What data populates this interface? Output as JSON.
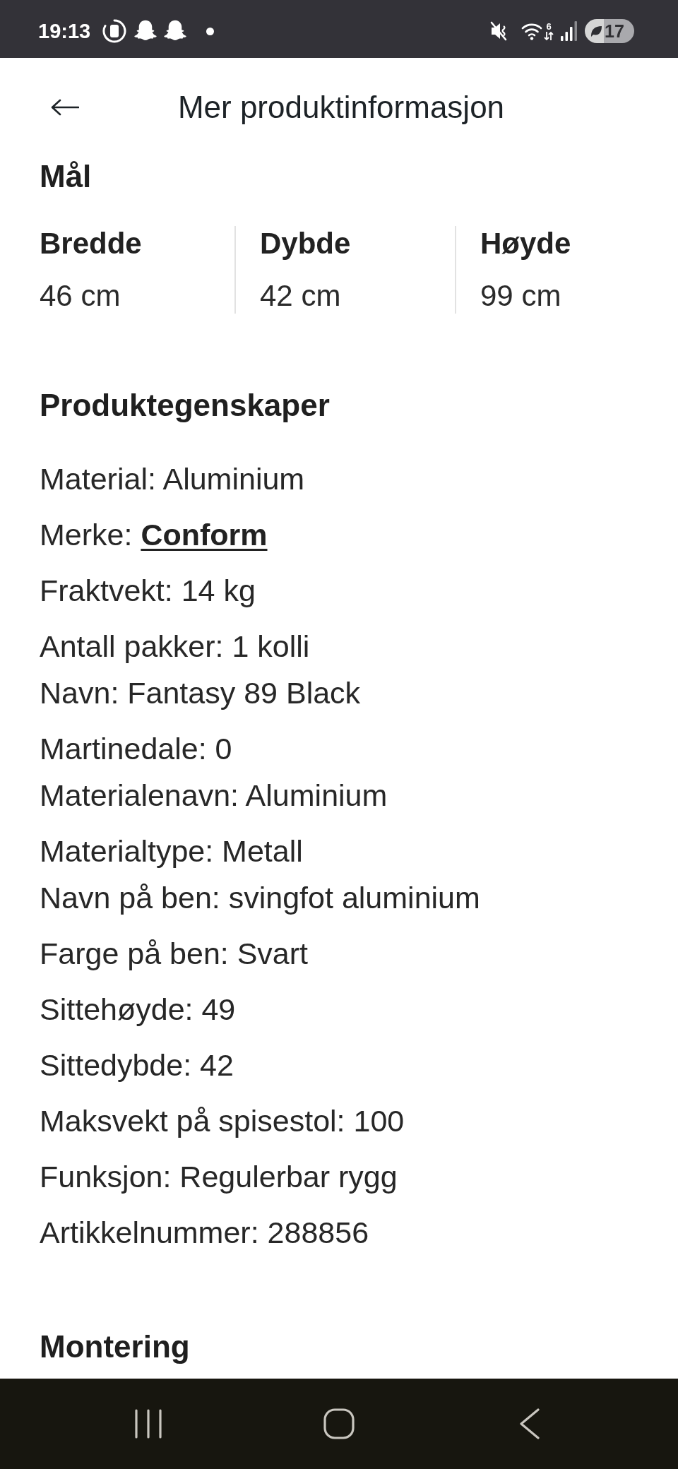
{
  "status_bar": {
    "time": "19:13",
    "wifi_badge": "6",
    "battery": "17"
  },
  "header": {
    "title": "Mer produktinformasjon"
  },
  "dimensions": {
    "heading": "Mål",
    "items": [
      {
        "label": "Bredde",
        "value": "46 cm"
      },
      {
        "label": "Dybde",
        "value": "42 cm"
      },
      {
        "label": "Høyde",
        "value": "99 cm"
      }
    ]
  },
  "properties": {
    "heading": "Produktegenskaper",
    "groups": [
      {
        "lines": [
          {
            "text": "Material: Aluminium"
          }
        ]
      },
      {
        "lines": [
          {
            "text": "Merke:",
            "link": "Conform"
          }
        ]
      },
      {
        "lines": [
          {
            "text": "Fraktvekt: 14 kg"
          }
        ]
      },
      {
        "lines": [
          {
            "text": "Antall pakker: 1 kolli"
          },
          {
            "text": "Navn: Fantasy 89 Black"
          }
        ]
      },
      {
        "lines": [
          {
            "text": "Martinedale: 0"
          },
          {
            "text": "Materialenavn: Aluminium"
          }
        ]
      },
      {
        "lines": [
          {
            "text": "Materialtype: Metall"
          },
          {
            "text": "Navn på ben: svingfot aluminium"
          }
        ]
      },
      {
        "lines": [
          {
            "text": "Farge på ben: Svart"
          }
        ]
      },
      {
        "lines": [
          {
            "text": "Sittehøyde: 49"
          }
        ]
      },
      {
        "lines": [
          {
            "text": "Sittedybde: 42"
          }
        ]
      },
      {
        "lines": [
          {
            "text": "Maksvekt på spisestol: 100"
          }
        ]
      },
      {
        "lines": [
          {
            "text": "Funksjon: Regulerbar rygg"
          }
        ]
      },
      {
        "lines": [
          {
            "text": "Artikkelnummer: 288856"
          }
        ]
      }
    ]
  },
  "next_section": {
    "heading": "Montering"
  }
}
